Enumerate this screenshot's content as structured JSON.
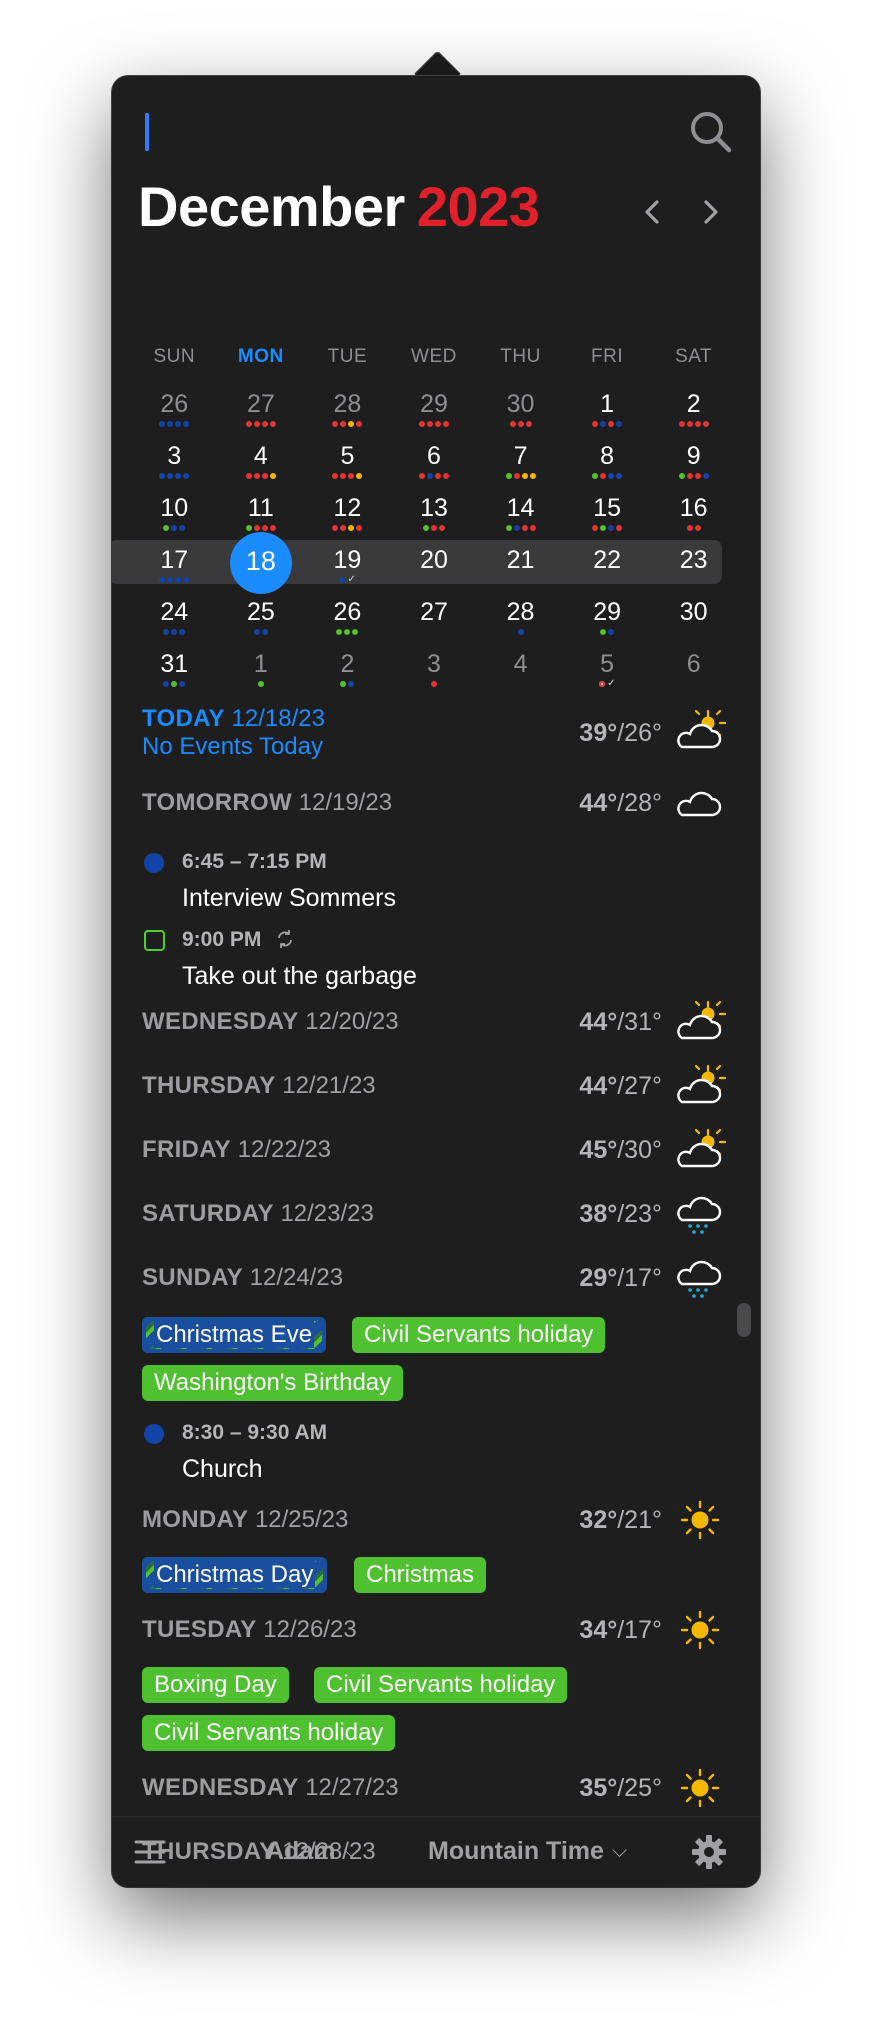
{
  "header": {
    "month": "December",
    "year": "2023"
  },
  "weekdays": [
    "SUN",
    "MON",
    "TUE",
    "WED",
    "THU",
    "FRI",
    "SAT"
  ],
  "calendar": {
    "weeks": [
      [
        {
          "n": "26",
          "other": true,
          "dots": [
            "blue",
            "blue",
            "blue",
            "blue"
          ]
        },
        {
          "n": "27",
          "other": true,
          "dots": [
            "red",
            "red",
            "red",
            "red"
          ]
        },
        {
          "n": "28",
          "other": true,
          "dots": [
            "red",
            "red",
            "yellow",
            "red"
          ]
        },
        {
          "n": "29",
          "other": true,
          "dots": [
            "red",
            "red",
            "red",
            "red"
          ]
        },
        {
          "n": "30",
          "other": true,
          "dots": [
            "red",
            "red",
            "red"
          ]
        },
        {
          "n": "1",
          "dots": [
            "red",
            "blue",
            "red",
            "blue"
          ]
        },
        {
          "n": "2",
          "dots": [
            "red",
            "red",
            "red",
            "red"
          ]
        }
      ],
      [
        {
          "n": "3",
          "dots": [
            "blue",
            "blue",
            "blue",
            "blue"
          ]
        },
        {
          "n": "4",
          "dots": [
            "red",
            "red",
            "red",
            "yellow"
          ]
        },
        {
          "n": "5",
          "dots": [
            "red",
            "red",
            "red",
            "yellow"
          ]
        },
        {
          "n": "6",
          "dots": [
            "red",
            "blue",
            "red",
            "red"
          ]
        },
        {
          "n": "7",
          "dots": [
            "green",
            "red",
            "yellow",
            "yellow"
          ]
        },
        {
          "n": "8",
          "dots": [
            "green",
            "red",
            "blue",
            "blue"
          ]
        },
        {
          "n": "9",
          "dots": [
            "green",
            "red",
            "red",
            "blue"
          ]
        }
      ],
      [
        {
          "n": "10",
          "dots": [
            "green",
            "blue",
            "blue"
          ]
        },
        {
          "n": "11",
          "dots": [
            "green",
            "red",
            "red",
            "red"
          ]
        },
        {
          "n": "12",
          "dots": [
            "red",
            "red",
            "yellow",
            "red"
          ]
        },
        {
          "n": "13",
          "dots": [
            "green",
            "red",
            "red"
          ]
        },
        {
          "n": "14",
          "dots": [
            "green",
            "blue",
            "red",
            "red"
          ]
        },
        {
          "n": "15",
          "dots": [
            "red",
            "green",
            "blue",
            "red"
          ]
        },
        {
          "n": "16",
          "dots": [
            "red",
            "red"
          ]
        }
      ],
      [
        {
          "n": "17",
          "dots": [
            "blue",
            "blue",
            "blue",
            "blue"
          ]
        },
        {
          "n": "18",
          "selected": true,
          "dots": []
        },
        {
          "n": "19",
          "dots": [
            "blue",
            "check"
          ]
        },
        {
          "n": "20",
          "dots": []
        },
        {
          "n": "21",
          "dots": []
        },
        {
          "n": "22",
          "dots": []
        },
        {
          "n": "23",
          "dots": []
        }
      ],
      [
        {
          "n": "24",
          "dots": [
            "blue",
            "blue",
            "blue"
          ]
        },
        {
          "n": "25",
          "dots": [
            "blue",
            "blue"
          ]
        },
        {
          "n": "26",
          "dots": [
            "green",
            "green",
            "green"
          ]
        },
        {
          "n": "27",
          "dots": []
        },
        {
          "n": "28",
          "dots": [
            "blue"
          ]
        },
        {
          "n": "29",
          "dots": [
            "green",
            "blue"
          ]
        },
        {
          "n": "30",
          "dots": []
        }
      ],
      [
        {
          "n": "31",
          "dots": [
            "blue",
            "green",
            "blue"
          ]
        },
        {
          "n": "1",
          "other": true,
          "dots": [
            "green"
          ]
        },
        {
          "n": "2",
          "other": true,
          "dots": [
            "green",
            "blue"
          ]
        },
        {
          "n": "3",
          "other": true,
          "dots": [
            "red"
          ]
        },
        {
          "n": "4",
          "other": true,
          "dots": []
        },
        {
          "n": "5",
          "other": true,
          "dots": [
            "ring",
            "check"
          ]
        },
        {
          "n": "6",
          "other": true,
          "dots": []
        }
      ]
    ]
  },
  "agenda": {
    "today": {
      "label": "TODAY",
      "date": "12/18/23",
      "sub": "No Events Today",
      "high": "39°",
      "low": "/26°",
      "icon": "partly-sunny-icon"
    },
    "tomorrow": {
      "label": "TOMORROW",
      "date": "12/19/23",
      "high": "44°",
      "low": "/28°",
      "icon": "cloud-icon"
    },
    "ev1": {
      "time": "6:45 – 7:15 PM",
      "title": "Interview Sommers"
    },
    "ev2": {
      "time": "9:00 PM",
      "title": "Take out the garbage"
    },
    "wed": {
      "label": "WEDNESDAY",
      "date": "12/20/23",
      "high": "44°",
      "low": "/31°"
    },
    "thu": {
      "label": "THURSDAY",
      "date": "12/21/23",
      "high": "44°",
      "low": "/27°"
    },
    "fri": {
      "label": "FRIDAY",
      "date": "12/22/23",
      "high": "45°",
      "low": "/30°"
    },
    "sat": {
      "label": "SATURDAY",
      "date": "12/23/23",
      "high": "38°",
      "low": "/23°"
    },
    "sun": {
      "label": "SUNDAY",
      "date": "12/24/23",
      "high": "29°",
      "low": "/17°",
      "tags": [
        "Christmas Eve",
        "Civil Servants holiday",
        "Washington's Birthday"
      ]
    },
    "ev3": {
      "time": "8:30 – 9:30 AM",
      "title": "Church"
    },
    "mon": {
      "label": "MONDAY",
      "date": "12/25/23",
      "high": "32°",
      "low": "/21°",
      "tags": [
        "Christmas Day",
        "Christmas"
      ]
    },
    "tue": {
      "label": "TUESDAY",
      "date": "12/26/23",
      "high": "34°",
      "low": "/17°",
      "tags": [
        "Boxing Day",
        "Civil Servants holiday",
        "Civil Servants holiday"
      ]
    },
    "wed2": {
      "label": "WEDNESDAY",
      "date": "12/27/23",
      "high": "35°",
      "low": "/25°"
    },
    "thu2": {
      "label": "THURSDAY",
      "date": "12/28/23"
    }
  },
  "footer": {
    "calendar_set": "Adam",
    "timezone": "Mountain Time"
  },
  "colors": {
    "accent": "#1a8cff",
    "year": "#e0202b",
    "holiday_green": "#4fc02f",
    "event_blue": "#1244a8"
  }
}
